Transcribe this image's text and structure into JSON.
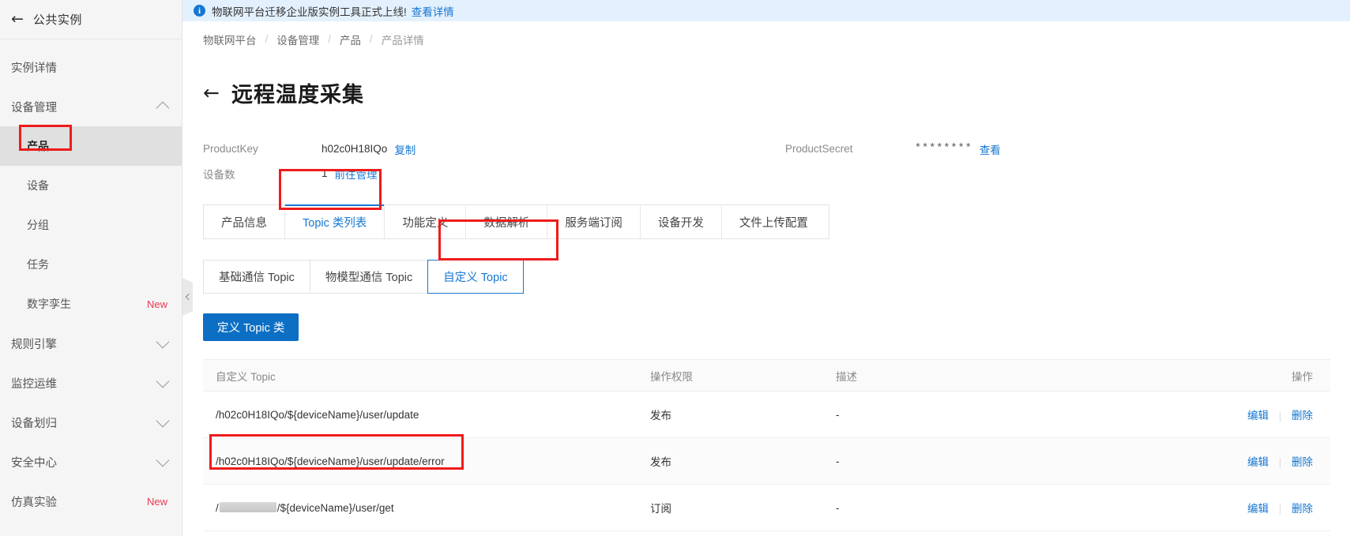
{
  "sidebar": {
    "back_icon": "arrow-left-icon",
    "title": "公共实例",
    "items": [
      {
        "label": "实例详情",
        "type": "item",
        "indent": false,
        "expand": null,
        "new": false,
        "active": false
      },
      {
        "label": "设备管理",
        "type": "group",
        "indent": false,
        "expand": "up",
        "new": false,
        "active": false
      },
      {
        "label": "产品",
        "type": "item",
        "indent": true,
        "expand": null,
        "new": false,
        "active": true
      },
      {
        "label": "设备",
        "type": "item",
        "indent": true,
        "expand": null,
        "new": false,
        "active": false
      },
      {
        "label": "分组",
        "type": "item",
        "indent": true,
        "expand": null,
        "new": false,
        "active": false
      },
      {
        "label": "任务",
        "type": "item",
        "indent": true,
        "expand": null,
        "new": false,
        "active": false
      },
      {
        "label": "数字孪生",
        "type": "item",
        "indent": true,
        "expand": null,
        "new": true,
        "active": false
      },
      {
        "label": "规则引擎",
        "type": "group",
        "indent": false,
        "expand": "down",
        "new": false,
        "active": false
      },
      {
        "label": "监控运维",
        "type": "group",
        "indent": false,
        "expand": "down",
        "new": false,
        "active": false
      },
      {
        "label": "设备划归",
        "type": "group",
        "indent": false,
        "expand": "down",
        "new": false,
        "active": false
      },
      {
        "label": "安全中心",
        "type": "group",
        "indent": false,
        "expand": "down",
        "new": false,
        "active": false
      },
      {
        "label": "仿真实验",
        "type": "item",
        "indent": false,
        "expand": null,
        "new": true,
        "active": false
      }
    ],
    "new_badge": "New"
  },
  "notice": {
    "icon": "info-circle-icon",
    "text": "物联网平台迁移企业版实例工具正式上线!",
    "link": "查看详情"
  },
  "breadcrumb": {
    "items": [
      "物联网平台",
      "设备管理",
      "产品",
      "产品详情"
    ],
    "separator": "/"
  },
  "page": {
    "back_icon": "arrow-left-icon",
    "title": "远程温度采集"
  },
  "meta": {
    "product_key_label": "ProductKey",
    "product_key_value": "h02c0H18IQo",
    "copy_label": "复制",
    "device_count_label": "设备数",
    "device_count_value": "1",
    "goto_manage_label": "前往管理",
    "product_secret_label": "ProductSecret",
    "product_secret_value": "********",
    "view_label": "查看"
  },
  "tabs": [
    {
      "label": "产品信息",
      "active": false
    },
    {
      "label": "Topic 类列表",
      "active": true
    },
    {
      "label": "功能定义",
      "active": false
    },
    {
      "label": "数据解析",
      "active": false
    },
    {
      "label": "服务端订阅",
      "active": false
    },
    {
      "label": "设备开发",
      "active": false
    },
    {
      "label": "文件上传配置",
      "active": false
    }
  ],
  "subtabs": [
    {
      "label": "基础通信 Topic",
      "active": false
    },
    {
      "label": "物模型通信 Topic",
      "active": false
    },
    {
      "label": "自定义 Topic",
      "active": true
    }
  ],
  "toolbar": {
    "define_topic_label": "定义 Topic 类"
  },
  "table": {
    "columns": [
      "自定义 Topic",
      "操作权限",
      "描述",
      "操作"
    ],
    "rows": [
      {
        "topic": "/h02c0H18IQo/${deviceName}/user/update",
        "topic_masked": false,
        "permission": "发布",
        "description": "-",
        "edit": "编辑",
        "delete": "删除"
      },
      {
        "topic": "/h02c0H18IQo/${deviceName}/user/update/error",
        "topic_masked": false,
        "permission": "发布",
        "description": "-",
        "edit": "编辑",
        "delete": "删除"
      },
      {
        "topic_prefix": "/",
        "topic_suffix": "/${deviceName}/user/get",
        "topic_masked": true,
        "permission": "订阅",
        "description": "-",
        "edit": "编辑",
        "delete": "删除"
      }
    ]
  },
  "colors": {
    "accent": "#1677d2",
    "button": "#0c6fc4",
    "highlight": "#ef1b1b",
    "new_badge": "#e8384f",
    "notice_bg": "#e3f0fd",
    "sidebar_bg": "#f5f5f5",
    "sidebar_active_bg": "#e0e0e0"
  },
  "collapse": {
    "icon": "chevron-left-icon"
  }
}
